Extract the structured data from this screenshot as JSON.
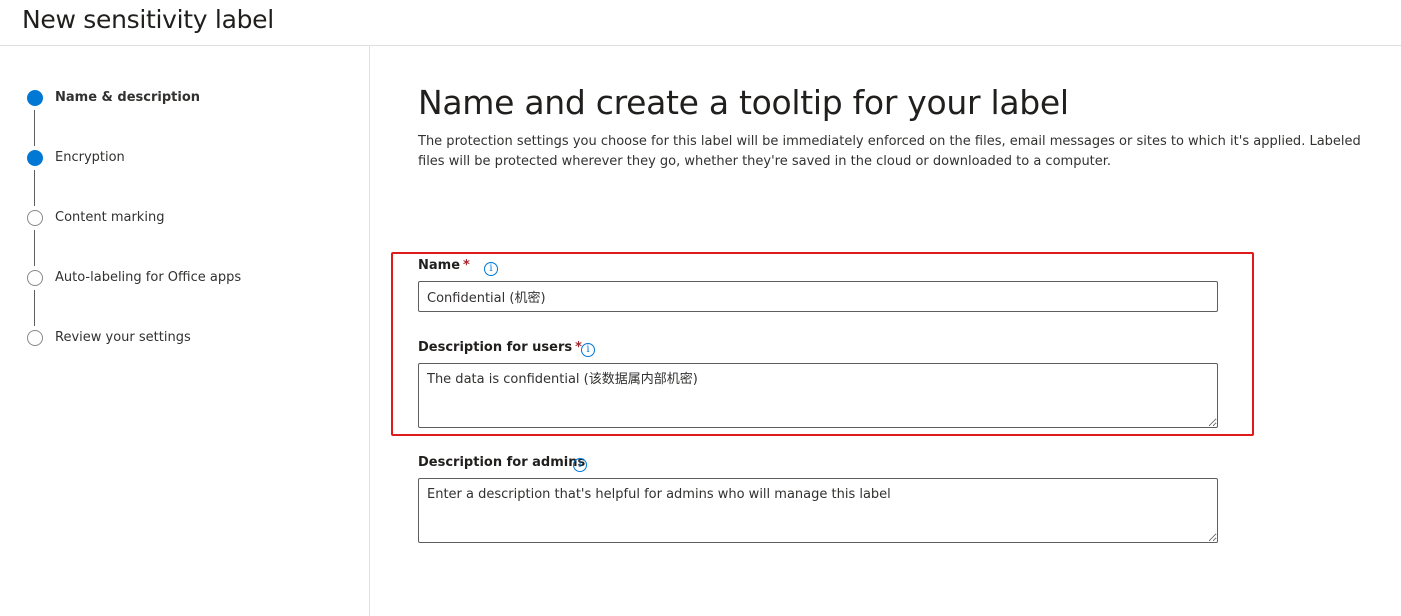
{
  "page": {
    "title": "New sensitivity label"
  },
  "steps": [
    {
      "label": "Name & description",
      "state": "done",
      "active": true
    },
    {
      "label": "Encryption",
      "state": "done",
      "active": false
    },
    {
      "label": "Content marking",
      "state": "todo",
      "active": false
    },
    {
      "label": "Auto-labeling for Office apps",
      "state": "todo",
      "active": false
    },
    {
      "label": "Review your settings",
      "state": "todo",
      "active": false
    }
  ],
  "main": {
    "heading": "Name and create a tooltip for your label",
    "intro": "The protection settings you choose for this label will be immediately enforced on the files, email messages or sites to which it's applied. Labeled files will be protected wherever they go, whether they're saved in the cloud or downloaded to a computer."
  },
  "form": {
    "name": {
      "label": "Name",
      "required_mark": "*",
      "value": "Confidential (机密)",
      "info_icon": "info-icon"
    },
    "user_description": {
      "label": "Description for users",
      "required_mark": "*",
      "value": "The data is confidential (该数据属内部机密)",
      "info_icon": "info-icon"
    },
    "admin_description": {
      "label": "Description for admins",
      "value": "",
      "placeholder": "Enter a description that's helpful for admins who will manage this label",
      "info_icon": "info-icon"
    }
  },
  "colors": {
    "accent": "#0078d4",
    "highlight_border": "#e0191b",
    "required": "#a4262c"
  }
}
